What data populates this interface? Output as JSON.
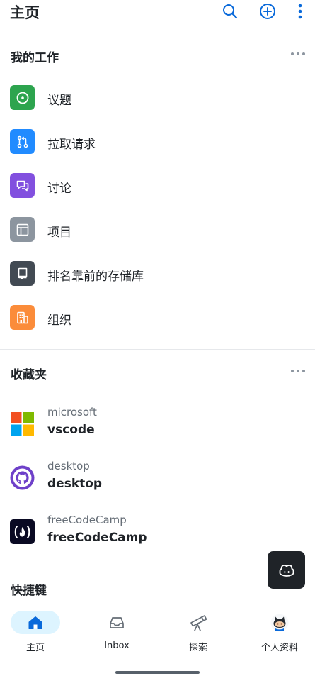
{
  "header": {
    "title": "主页",
    "search_icon": "search-icon",
    "add_icon": "plus-circle-icon",
    "menu_icon": "kebab-vertical-icon"
  },
  "my_work": {
    "title": "我的工作",
    "items": [
      {
        "label": "议题",
        "icon": "issue-opened-icon",
        "color": "#2da44e"
      },
      {
        "label": "拉取请求",
        "icon": "git-pull-request-icon",
        "color": "#218bff"
      },
      {
        "label": "讨论",
        "icon": "comment-discussion-icon",
        "color": "#8250df"
      },
      {
        "label": "项目",
        "icon": "table-icon",
        "color": "#8c959f"
      },
      {
        "label": "排名靠前的存储库",
        "icon": "repo-icon",
        "color": "#424a53"
      },
      {
        "label": "组织",
        "icon": "organization-icon",
        "color": "#fb8c3a"
      }
    ]
  },
  "favorites": {
    "title": "收藏夹",
    "items": [
      {
        "owner": "microsoft",
        "name": "vscode",
        "avatar": "microsoft-logo"
      },
      {
        "owner": "desktop",
        "name": "desktop",
        "avatar": "github-desktop-logo"
      },
      {
        "owner": "freeCodeCamp",
        "name": "freeCodeCamp",
        "avatar": "freecodecamp-logo"
      }
    ]
  },
  "shortcuts": {
    "title": "快捷键"
  },
  "copilot": {
    "icon": "copilot-icon"
  },
  "tabbar": {
    "tabs": [
      {
        "label": "主页",
        "icon": "home-icon",
        "active": true
      },
      {
        "label": "Inbox",
        "icon": "inbox-icon",
        "active": false
      },
      {
        "label": "探索",
        "icon": "telescope-icon",
        "active": false
      },
      {
        "label": "个人资料",
        "icon": "octocat-avatar",
        "active": false
      }
    ]
  },
  "colors": {
    "accent": "#0969da",
    "active_tab_bg": "#ddf4ff",
    "text_primary": "#1f2328",
    "text_secondary": "#656d76"
  }
}
